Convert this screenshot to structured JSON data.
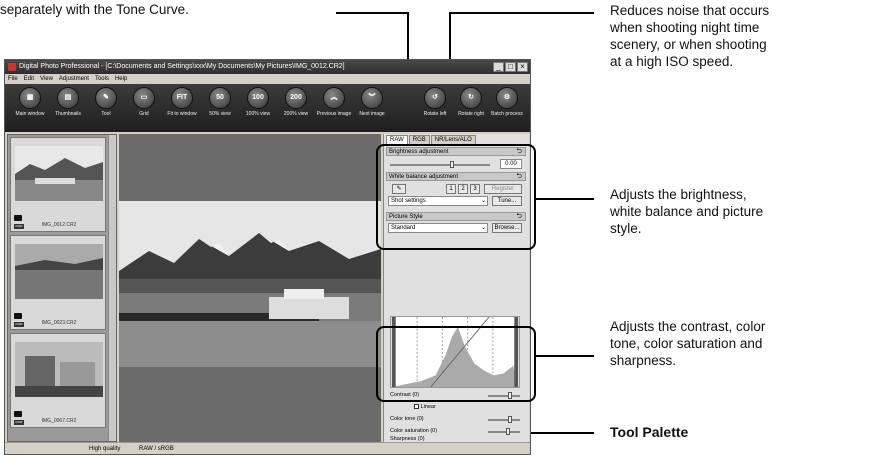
{
  "annotations": {
    "top_left": "separately with the Tone Curve.",
    "noise_reduction": [
      "Reduces noise that occurs",
      "when shooting night time",
      "scenery, or when shooting",
      "at a high ISO speed."
    ],
    "brightness": [
      "Adjusts the brightness,",
      "white balance and picture",
      "style."
    ],
    "contrast": [
      "Adjusts the contrast, color",
      "tone, color saturation and",
      "sharpness."
    ],
    "tool_palette": "Tool Palette"
  },
  "window": {
    "title": "Digital Photo Professional - [C:\\Documents and Settings\\xxx\\My Documents\\My Pictures\\IMG_0012.CR2]",
    "menu": [
      "File",
      "Edit",
      "View",
      "Adjustment",
      "Tools",
      "Help"
    ]
  },
  "toolbar": [
    {
      "label": "Main window",
      "glyph": "▦"
    },
    {
      "label": "Thumbnails",
      "glyph": "▤"
    },
    {
      "label": "Tool",
      "glyph": "✎"
    },
    {
      "label": "Grid",
      "glyph": "▭"
    },
    {
      "label": "Fit to window",
      "glyph": "FIT"
    },
    {
      "label": "50% view",
      "glyph": "50"
    },
    {
      "label": "100% view",
      "glyph": "100"
    },
    {
      "label": "200% view",
      "glyph": "200"
    },
    {
      "label": "Previous image",
      "glyph": "︽"
    },
    {
      "label": "Next image",
      "glyph": "︾"
    },
    {
      "label": "Rotate left",
      "glyph": "↺"
    },
    {
      "label": "Rotate right",
      "glyph": "↻"
    },
    {
      "label": "Batch process",
      "glyph": "⚙"
    }
  ],
  "thumbnails": [
    "IMG_0012.CR2",
    "IMG_0023.CR2",
    "IMG_0067.CR2"
  ],
  "palette": {
    "tabs": [
      "RAW",
      "RGB",
      "NR/Lens/ALO"
    ],
    "brightness_label": "Brightness adjustment",
    "brightness_value": "0.00",
    "wb_label": "White balance adjustment",
    "wb_numbers": [
      "1",
      "2",
      "3"
    ],
    "wb_register": "Register",
    "wb_select": "Shot settings",
    "wb_tune": "Tune...",
    "ps_label": "Picture Style",
    "ps_select": "Standard",
    "ps_browse": "Browse...",
    "contrast": "Contrast (0)",
    "linear": "Linear",
    "color_tone": "Color tone (0)",
    "color_saturation": "Color saturation (0)",
    "sharpness": "Sharpness (0)"
  },
  "status": {
    "quality": "High quality",
    "format": "RAW / sRGB"
  }
}
